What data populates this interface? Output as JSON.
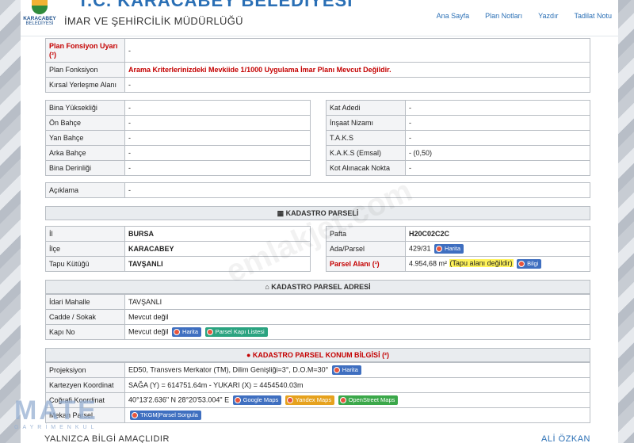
{
  "header": {
    "logo_line1": "KARACABEY",
    "logo_line2": "BELEDİYESİ",
    "site_title": "T.C. KARACABEY BELEDİYESİ",
    "dept_title": "İMAR VE ŞEHİRCİLİK MÜDÜRLÜĞÜ",
    "nav": [
      "Ana Sayfa",
      "Plan Notları",
      "Yazdır",
      "Tadilat Notu"
    ]
  },
  "plan": {
    "fonksiyon_uyari_label": "Plan Fonsiyon Uyarı (²)",
    "fonksiyon_uyari_value": "-",
    "fonksiyon_label": "Plan Fonksiyon",
    "fonksiyon_value": "Arama Kriterlerinizdeki Mevkiide 1/1000 Uygulama İmar Planı Mevcut Değildir.",
    "kirsal_label": "Kırsal Yerleşme Alanı",
    "kirsal_value": "-"
  },
  "building_left": [
    {
      "label": "Bina Yüksekliği",
      "value": "-"
    },
    {
      "label": "Ön Bahçe",
      "value": "-"
    },
    {
      "label": "Yan Bahçe",
      "value": "-"
    },
    {
      "label": "Arka Bahçe",
      "value": "-"
    },
    {
      "label": "Bina Derinliği",
      "value": "-"
    }
  ],
  "building_right": [
    {
      "label": "Kat Adedi",
      "value": "-"
    },
    {
      "label": "İnşaat Nizamı",
      "value": "-"
    },
    {
      "label": "T.A.K.S",
      "value": "-"
    },
    {
      "label": "K.A.K.S (Emsal)",
      "value": "- (0,50)"
    },
    {
      "label": "Kot Alınacak Nokta",
      "value": "-"
    }
  ],
  "aciklama": {
    "label": "Açıklama",
    "value": "-"
  },
  "kadastro": {
    "title": "KADASTRO PARSELİ",
    "il_label": "İl",
    "il_value": "BURSA",
    "ilce_label": "İlçe",
    "ilce_value": "KARACABEY",
    "tapu_label": "Tapu Kütüğü",
    "tapu_value": "TAVŞANLI",
    "pafta_label": "Pafta",
    "pafta_value": "H20C02C2C",
    "ada_label": "Ada/Parsel",
    "ada_value": "429/31",
    "ada_btn": "Harita",
    "alan_label": "Parsel Alanı (¹)",
    "alan_value": "4.954,68 m²",
    "alan_note": "(Tapu alanı değildir)",
    "alan_btn": "Bilgi"
  },
  "adres": {
    "title": "KADASTRO PARSEL ADRESİ",
    "mahalle_label": "İdari Mahalle",
    "mahalle_value": "TAVŞANLI",
    "cadde_label": "Cadde / Sokak",
    "cadde_value": "Mevcut değil",
    "kapi_label": "Kapı No",
    "kapi_value": "Mevcut değil",
    "kapi_btn1": "Harita",
    "kapi_btn2": "Parsel Kapı Listesi"
  },
  "konum": {
    "title": "KADASTRO PARSEL KONUM BİLGİSİ (²)",
    "proj_label": "Projeksiyon",
    "proj_value": "ED50, Transvers Merkator (TM), Dilim Genişliği=3°, D.O.M=30°",
    "proj_btn": "Harita",
    "kart_label": "Kartezyen Koordinat",
    "kart_value": "SAĞA (Y) = 614751.64m - YUKARI (X) = 4454540.03m",
    "cog_label": "Coğrafi Koordinat",
    "cog_value": "40°13'2.636\" N 28°20'53.004\" E",
    "cog_btn1": "Google Maps",
    "cog_btn2": "Yandex Maps",
    "cog_btn3": "OpenStreet Maps",
    "mekan_label": "Mekan Parsel",
    "mekan_btn": "TKGM|Parsel Sorgula"
  },
  "footer": {
    "left": "YALNIZCA BİLGİ AMAÇLIDIR",
    "right": "ALİ ÖZKAN"
  },
  "overlay": {
    "watermark": "emlakjet.com",
    "brand": "MATE",
    "brand_sub": "GAYRİMENKUL"
  }
}
